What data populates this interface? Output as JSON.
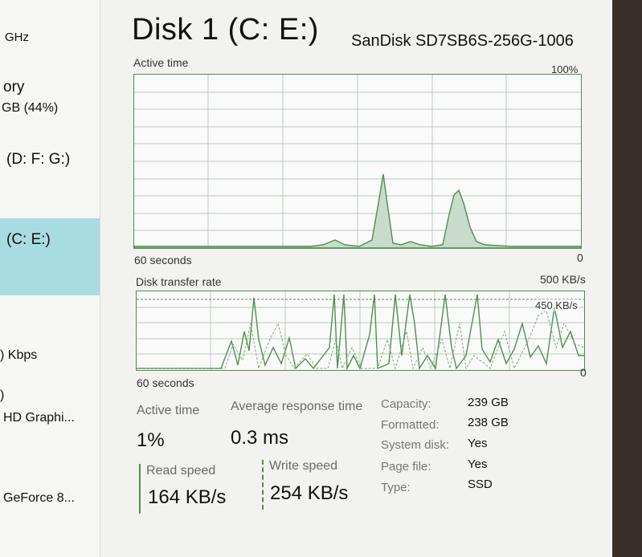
{
  "sidebar": {
    "items": [
      {
        "text": "GHz"
      },
      {
        "text": "ory"
      },
      {
        "text": "GB (44%)"
      },
      {
        "text": "(D: F: G:)"
      },
      {
        "text": "(C: E:)"
      },
      {
        "text": ") Kbps"
      },
      {
        "text": ")"
      },
      {
        "text": "HD Graphi..."
      },
      {
        "text": "GeForce 8..."
      }
    ]
  },
  "header": {
    "title": "Disk 1 (C: E:)",
    "model": "SanDisk SD7SB6S-256G-1006"
  },
  "active_graph": {
    "label": "Active time",
    "max_label": "100%",
    "time_label": "60 seconds",
    "min_label": "0"
  },
  "transfer_graph": {
    "label": "Disk transfer rate",
    "max_label": "500 KB/s",
    "line_label": "450 KB/s",
    "time_label": "60 seconds",
    "min_label": "0"
  },
  "stats": {
    "active_time_label": "Active time",
    "active_time_value": "1%",
    "response_label": "Average response time",
    "response_value": "0.3 ms",
    "read_label": "Read speed",
    "read_value": "164 KB/s",
    "write_label": "Write speed",
    "write_value": "254 KB/s"
  },
  "properties": [
    {
      "key": "Capacity:",
      "value": "239 GB"
    },
    {
      "key": "Formatted:",
      "value": "238 GB"
    },
    {
      "key": "System disk:",
      "value": "Yes"
    },
    {
      "key": "Page file:",
      "value": "Yes"
    },
    {
      "key": "Type:",
      "value": "SSD"
    }
  ],
  "colors": {
    "accent": "#4f8f4f",
    "selected": "#a9dbe2"
  }
}
